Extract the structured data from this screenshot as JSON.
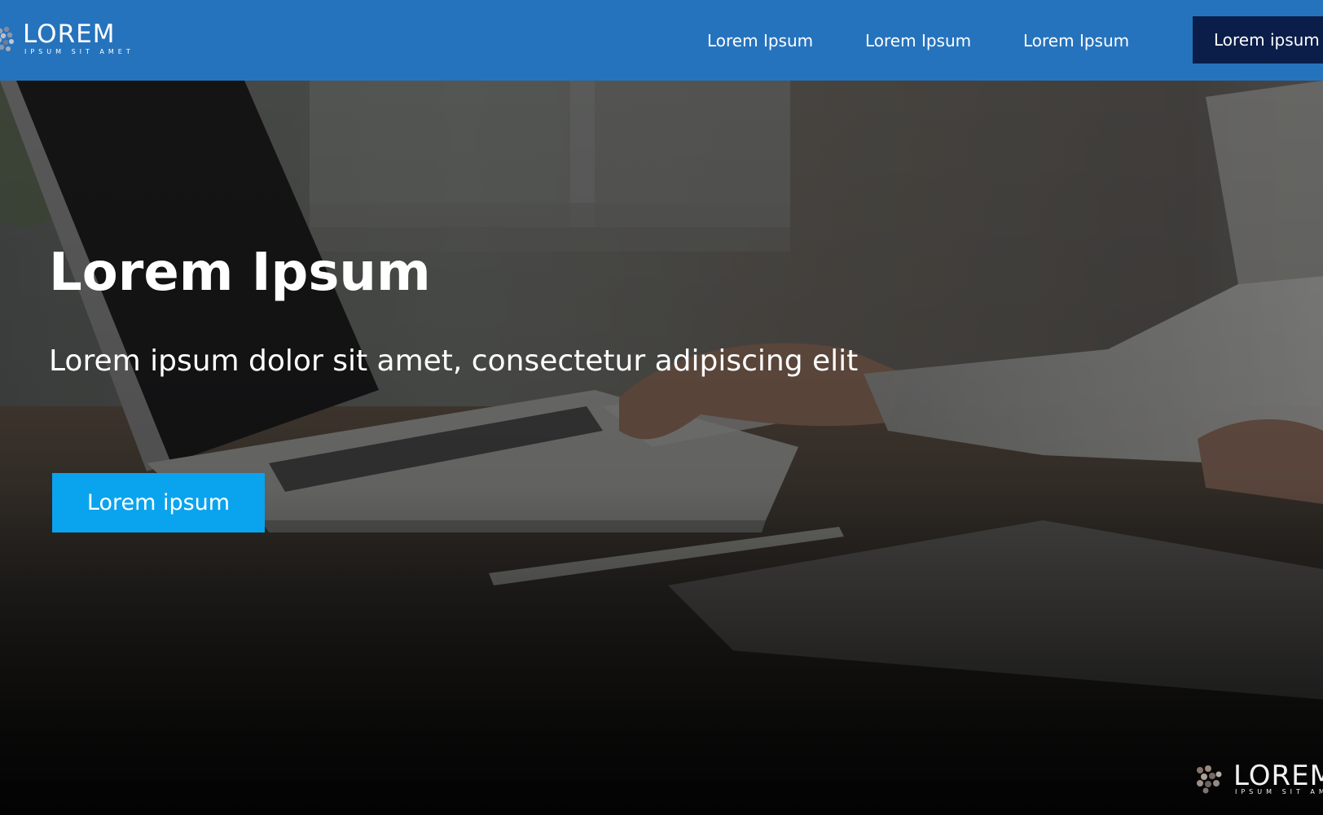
{
  "header": {
    "logo": {
      "name": "LOREM",
      "tagline": "IPSUM SIT AMET",
      "icon": "hexagon-cluster-icon"
    },
    "nav": {
      "links": [
        "Lorem Ipsum",
        "Lorem Ipsum",
        "Lorem Ipsum"
      ],
      "cta_label": "Lorem ipsum"
    }
  },
  "hero": {
    "title": "Lorem Ipsum",
    "subtitle": "Lorem ipsum dolor sit amet, consectetur adipiscing elit",
    "button_label": "Lorem ipsum",
    "watermark": {
      "name": "LOREM",
      "tagline": "IPSUM SIT AMET"
    }
  },
  "colors": {
    "header_bg": "#2673bd",
    "nav_cta_bg": "#0b1e4a",
    "hero_button_bg": "#0aa4ee",
    "text": "#ffffff"
  }
}
